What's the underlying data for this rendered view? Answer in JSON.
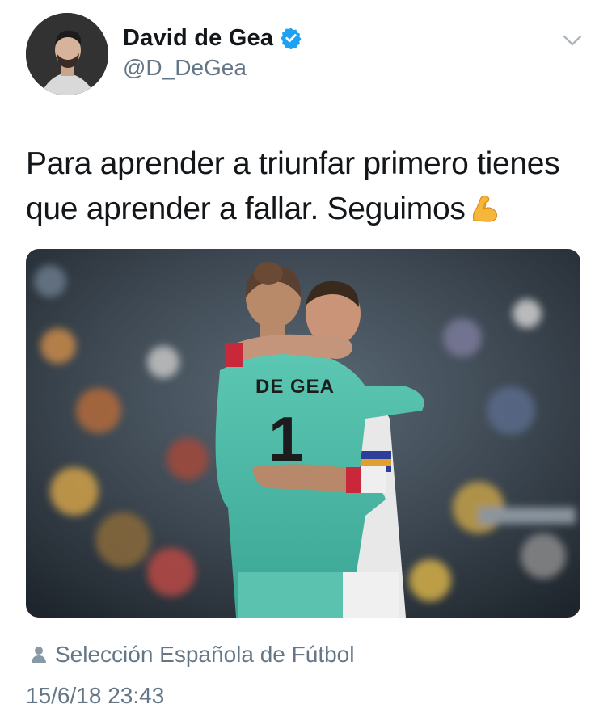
{
  "user": {
    "display_name": "David de Gea",
    "handle": "@D_DeGea",
    "verified": true,
    "verified_color": "#1da1f2"
  },
  "tweet": {
    "text": "Para aprender a triunfar primero tienes que aprender a fallar. Seguimos",
    "emoji": "flexed-biceps",
    "photo": {
      "jersey_name": "DE GEA",
      "jersey_number": "1"
    }
  },
  "meta": {
    "location": "Selección Española de Fútbol",
    "timestamp": "15/6/18 23:43"
  },
  "icons": {
    "menu": "chevron-down-icon",
    "location": "person-icon",
    "verified": "verified-badge-icon"
  },
  "colors": {
    "text_primary": "#14171a",
    "text_secondary": "#657786",
    "jersey": "#4dbba8"
  }
}
